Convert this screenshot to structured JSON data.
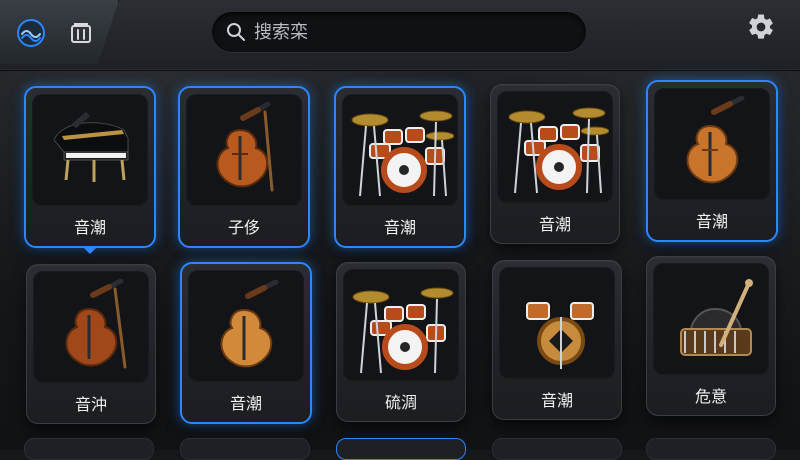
{
  "header": {
    "search": {
      "placeholder": "搜索栾",
      "value": ""
    },
    "icons": {
      "left_logo": "wave-logo-icon",
      "left_folder": "folder-icon",
      "search": "search-icon",
      "settings": "gear-icon"
    }
  },
  "grid": {
    "row1": [
      {
        "label": "音潮",
        "selected": true,
        "icon": "grand-piano-icon"
      },
      {
        "label": "子侈",
        "selected": true,
        "icon": "violin-icon"
      },
      {
        "label": "音潮",
        "selected": true,
        "icon": "drum-kit-icon"
      },
      {
        "label": "音潮",
        "selected": false,
        "icon": "drum-kit-icon"
      },
      {
        "label": "音潮",
        "selected": true,
        "icon": "violin-icon"
      }
    ],
    "row2": [
      {
        "label": "音沖",
        "selected": false,
        "icon": "violin-icon"
      },
      {
        "label": "音潮",
        "selected": true,
        "icon": "violin-icon"
      },
      {
        "label": "硫淍",
        "selected": false,
        "icon": "drum-kit-icon"
      },
      {
        "label": "音潮",
        "selected": false,
        "icon": "drum-small-icon"
      },
      {
        "label": "危意",
        "selected": false,
        "icon": "guzheng-icon"
      }
    ]
  },
  "colors": {
    "accent": "#2b86ff",
    "background": "#15171a"
  }
}
